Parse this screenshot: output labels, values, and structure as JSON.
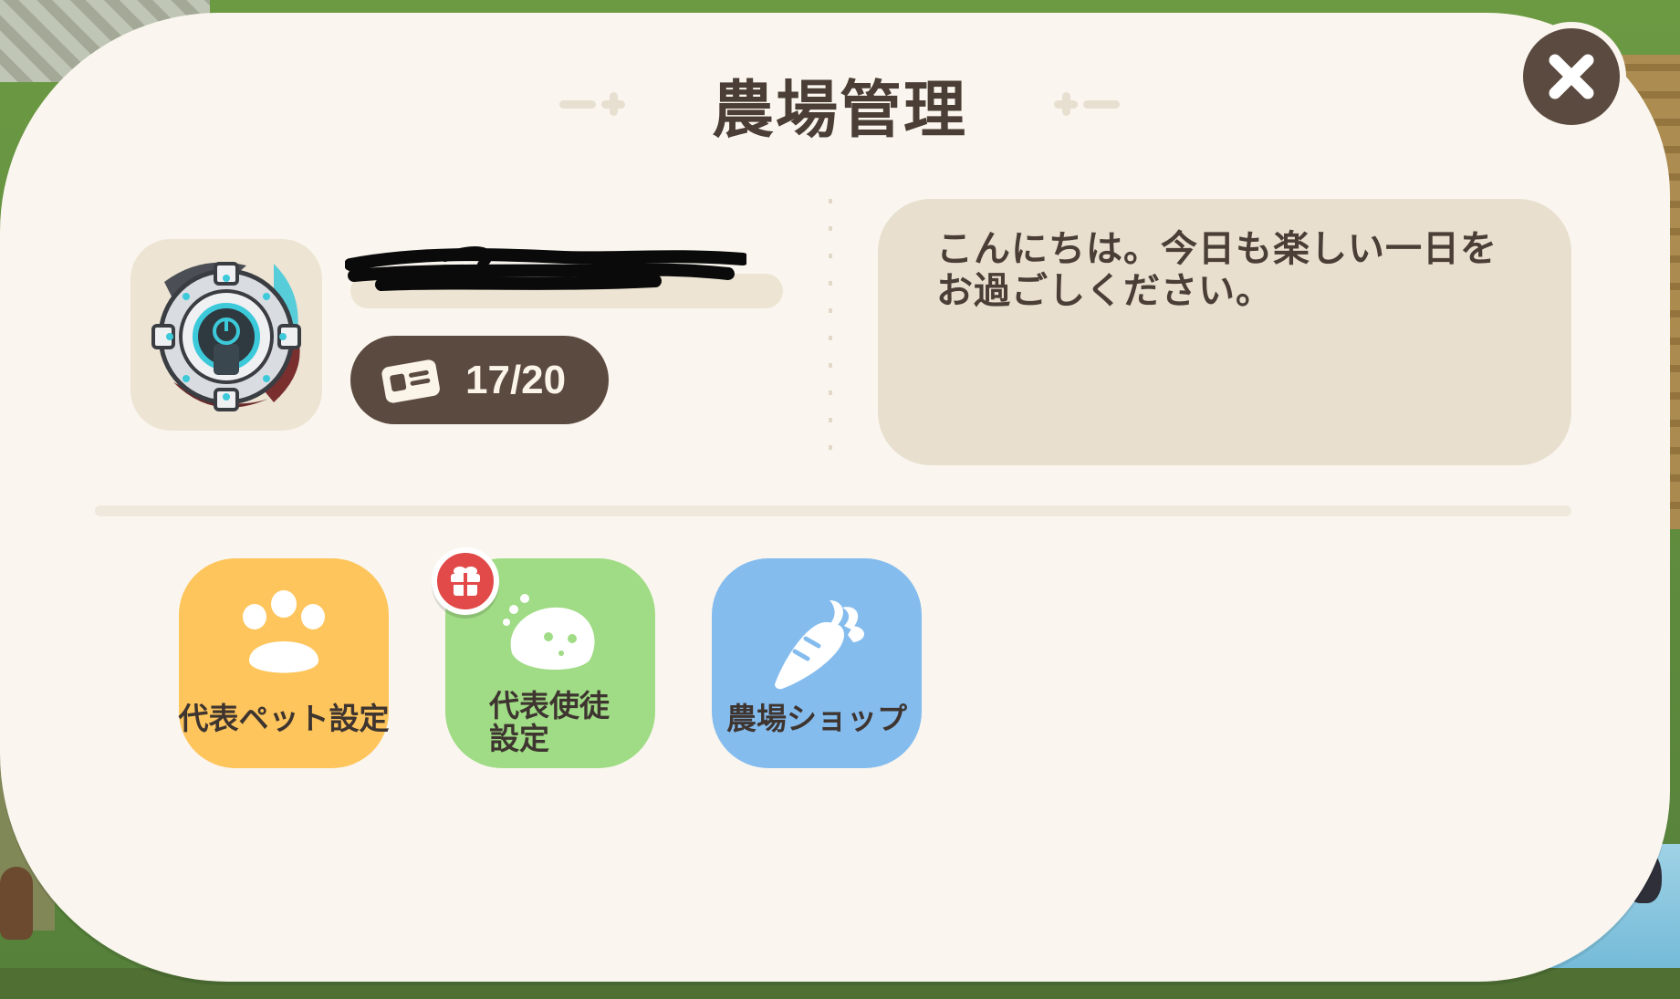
{
  "screen": {
    "title": "農場管理"
  },
  "profile": {
    "card_count": "17/20"
  },
  "greeting": {
    "text": "こんにちは。今日も楽しい一日をお過ごしください。"
  },
  "actions": [
    {
      "label": "代表ペット設定",
      "color": "#fec55c",
      "icon": "paw-icon"
    },
    {
      "label": "代表使徒\n設定",
      "color": "#a0db85",
      "icon": "spirit-icon",
      "badge": "gift-icon"
    },
    {
      "label": "農場ショップ",
      "color": "#85bcee",
      "icon": "carrot-icon"
    }
  ],
  "colors": {
    "panel": "#faf6ef",
    "dark": "#5b4a3f",
    "badge": "#e24a4a"
  }
}
